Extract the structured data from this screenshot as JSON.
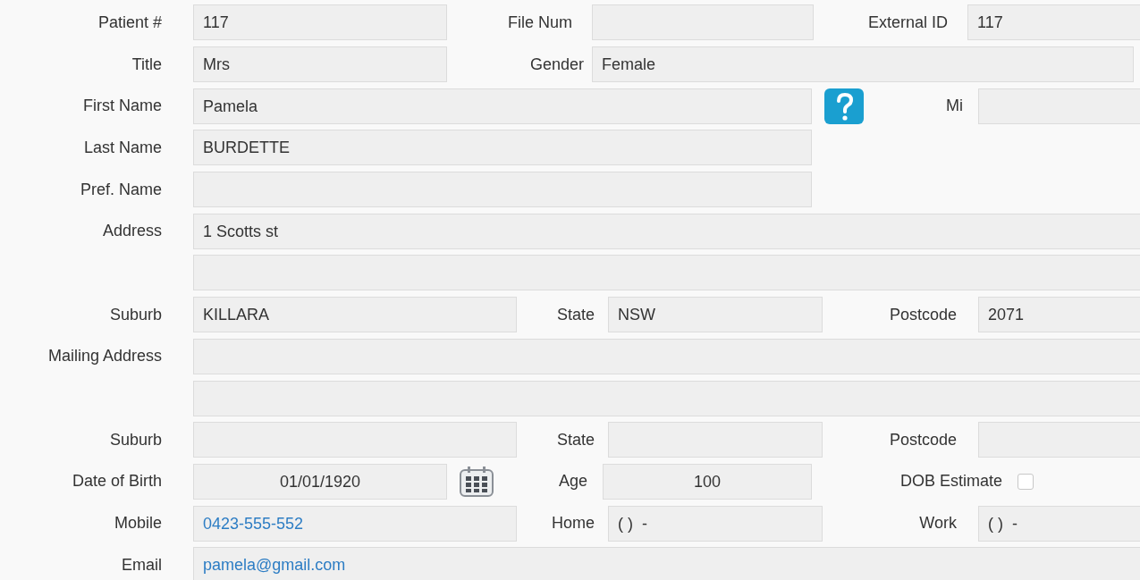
{
  "form": [
    {
      "label": "Patient #",
      "value": "117"
    },
    {
      "label": "File Num"
    },
    {
      "label": "External ID",
      "value": "117"
    },
    {
      "label": "Title",
      "value": "Mrs"
    },
    {
      "label": "Gender",
      "value": "Female"
    },
    {
      "label": "First Name",
      "value": "Pamela"
    },
    {
      "label": "Mi"
    },
    {
      "label": "Last Name",
      "value": "BURDETTE"
    },
    {
      "label": "Pref. Name"
    },
    {
      "label": "Address",
      "value": "1 Scotts st"
    },
    {
      "label": "Suburb",
      "value": "KILLARA"
    },
    {
      "label": "State",
      "value": "NSW"
    },
    {
      "label": "Postcode",
      "value": "2071"
    },
    {
      "label": "Mailing Address"
    },
    {
      "label": "Suburb"
    },
    {
      "label": "State"
    },
    {
      "label": "Postcode"
    },
    {
      "label": "Date of Birth",
      "value": "01/01/1920"
    },
    {
      "label": "Age",
      "value": "100"
    },
    {
      "label": "DOB Estimate",
      "checked": false
    },
    {
      "label": "Mobile",
      "value": "0423-555-552"
    },
    {
      "label": "Home",
      "value": "( )  -"
    },
    {
      "label": "Work",
      "value": "( )  -"
    },
    {
      "label": "Email",
      "value": "pamela@gmail.com"
    }
  ]
}
